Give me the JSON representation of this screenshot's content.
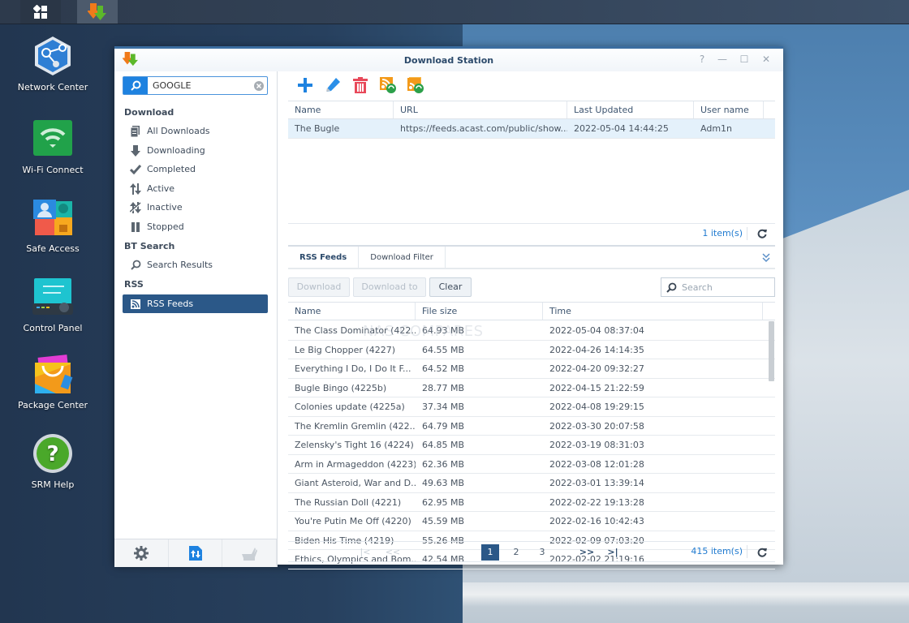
{
  "desktop": {
    "icons": [
      {
        "label": "Network Center"
      },
      {
        "label": "Wi-Fi Connect"
      },
      {
        "label": "Safe Access"
      },
      {
        "label": "Control Panel"
      },
      {
        "label": "Package Center"
      },
      {
        "label": "SRM Help"
      }
    ]
  },
  "window": {
    "title": "Download Station",
    "controls": {
      "help": "?",
      "minimize": "—",
      "maximize": "☐",
      "close": "✕"
    }
  },
  "sidebar": {
    "search_value": "GOOGLE",
    "sections": [
      {
        "label": "Download",
        "items": [
          {
            "label": "All Downloads",
            "icon": "document-icon"
          },
          {
            "label": "Downloading",
            "icon": "arrow-down-icon"
          },
          {
            "label": "Completed",
            "icon": "checkmark-icon"
          },
          {
            "label": "Active",
            "icon": "up-down-arrows-icon"
          },
          {
            "label": "Inactive",
            "icon": "inactive-icon"
          },
          {
            "label": "Stopped",
            "icon": "pause-icon"
          }
        ]
      },
      {
        "label": "BT Search",
        "items": [
          {
            "label": "Search Results",
            "icon": "search-icon"
          }
        ]
      },
      {
        "label": "RSS",
        "items": [
          {
            "label": "RSS Feeds",
            "icon": "rss-icon",
            "active": true
          }
        ]
      }
    ],
    "bottom": [
      "settings-icon",
      "transfer-icon",
      "emule-icon"
    ]
  },
  "toolbar": {
    "buttons": [
      "add-icon",
      "edit-icon",
      "delete-icon",
      "rss-refresh-icon",
      "rss-refresh-all-icon"
    ]
  },
  "feeds_table": {
    "columns": [
      "Name",
      "URL",
      "Last Updated",
      "User name"
    ],
    "rows": [
      {
        "name": "The Bugle",
        "url": "https://feeds.acast.com/public/show...",
        "last_updated": "2022-05-04 14:44:25",
        "user": "Adm1n"
      }
    ],
    "count": "1 item(s)"
  },
  "tabs": [
    "RSS Feeds",
    "Download Filter"
  ],
  "actions": {
    "download": "Download",
    "download_to": "Download to",
    "clear": "Clear",
    "search_placeholder": "Search"
  },
  "items_table": {
    "columns": [
      "Name",
      "File size",
      "Time"
    ],
    "rows": [
      {
        "name": "The Class Dominator (422...",
        "size": "64.93 MB",
        "time": "2022-05-04 08:37:04"
      },
      {
        "name": "Le Big Chopper (4227)",
        "size": "64.55 MB",
        "time": "2022-04-26 14:14:35"
      },
      {
        "name": "Everything I Do, I Do It F...",
        "size": "64.52 MB",
        "time": "2022-04-20 09:32:27"
      },
      {
        "name": "Bugle Bingo (4225b)",
        "size": "28.77 MB",
        "time": "2022-04-15 21:22:59"
      },
      {
        "name": "Colonies update (4225a)",
        "size": "37.34 MB",
        "time": "2022-04-08 19:29:15"
      },
      {
        "name": "The Kremlin Gremlin (422...",
        "size": "64.79 MB",
        "time": "2022-03-30 20:07:58"
      },
      {
        "name": "Zelensky's Tight 16 (4224)",
        "size": "64.85 MB",
        "time": "2022-03-19 08:31:03"
      },
      {
        "name": "Arm in Armageddon (4223)",
        "size": "62.36 MB",
        "time": "2022-03-08 12:01:28"
      },
      {
        "name": "Giant Asteroid, War and D...",
        "size": "49.63 MB",
        "time": "2022-03-01 13:39:14"
      },
      {
        "name": "The Russian Doll (4221)",
        "size": "62.95 MB",
        "time": "2022-02-22 19:13:28"
      },
      {
        "name": "You're Putin Me Off (4220)",
        "size": "45.59 MB",
        "time": "2022-02-16 10:42:43"
      },
      {
        "name": "Biden His Time (4219)",
        "size": "55.26 MB",
        "time": "2022-02-09 07:03:20"
      },
      {
        "name": "Ethics, Olympics and Bom...",
        "size": "42.54 MB",
        "time": "2022-02-02 21:19:16"
      }
    ],
    "watermark": "NAS COMPARES"
  },
  "pager": {
    "first": "|<",
    "prev": "<<",
    "pages": [
      "1",
      "2",
      "3"
    ],
    "current": "1",
    "next": ">>",
    "last": ">|",
    "count": "415 item(s)"
  }
}
